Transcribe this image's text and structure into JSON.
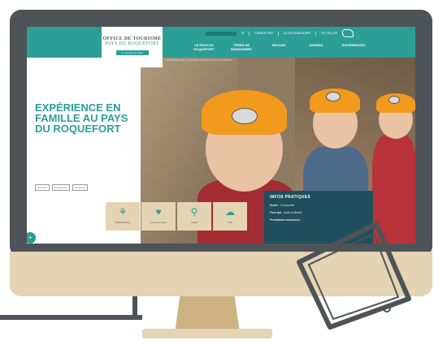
{
  "logo": {
    "line1": "OFFICE DE TOURISME",
    "line2": "PAYS DU ROQUEFORT",
    "tagline": "Ici, ce qui a du goût"
  },
  "topbar": {
    "links": [
      "ESPACE PRO",
      "ACCÈS HANDICAPÉ"
    ],
    "languages": "FR | EN | ES"
  },
  "nav": [
    "LE PAYS DU ROQUEFORT",
    "TERRE DE RANDONNÉE",
    "SÉJOUR",
    "AGENDA",
    "EXPÉRIENCES"
  ],
  "breadcrumb": "> EXPÉRIENCES > EN FAMILLE AU PAYS DU ROQUEFORT",
  "hero": {
    "title": "EXPÉRIENCE EN FAMILLE AU PAYS DU ROQUEFORT"
  },
  "tags": [
    "#journée",
    "#randonnée",
    "#roquefort"
  ],
  "icons": [
    {
      "icon": "family-icon",
      "glyph": "⚘",
      "label": "Multi-activités"
    },
    {
      "icon": "heart-icon",
      "glyph": "♥",
      "label": "Coup de coeur"
    },
    {
      "icon": "child-icon",
      "glyph": "⚲",
      "label": "Guide"
    },
    {
      "icon": "cheese-icon",
      "glyph": "☁",
      "label": "Tribu"
    }
  ],
  "info": {
    "title": "INFOS PRATIQUES",
    "lines": [
      {
        "key": "Durée",
        "value": "1/2 journée"
      },
      {
        "key": "Pour qui",
        "value": "toute la famille"
      },
      {
        "key": "Prestations associées",
        "value": ""
      }
    ]
  },
  "colors": {
    "teal": "#2b9e96",
    "beige": "#e4d4b3",
    "frame": "#4d5357",
    "navy": "#1f4f5c"
  }
}
